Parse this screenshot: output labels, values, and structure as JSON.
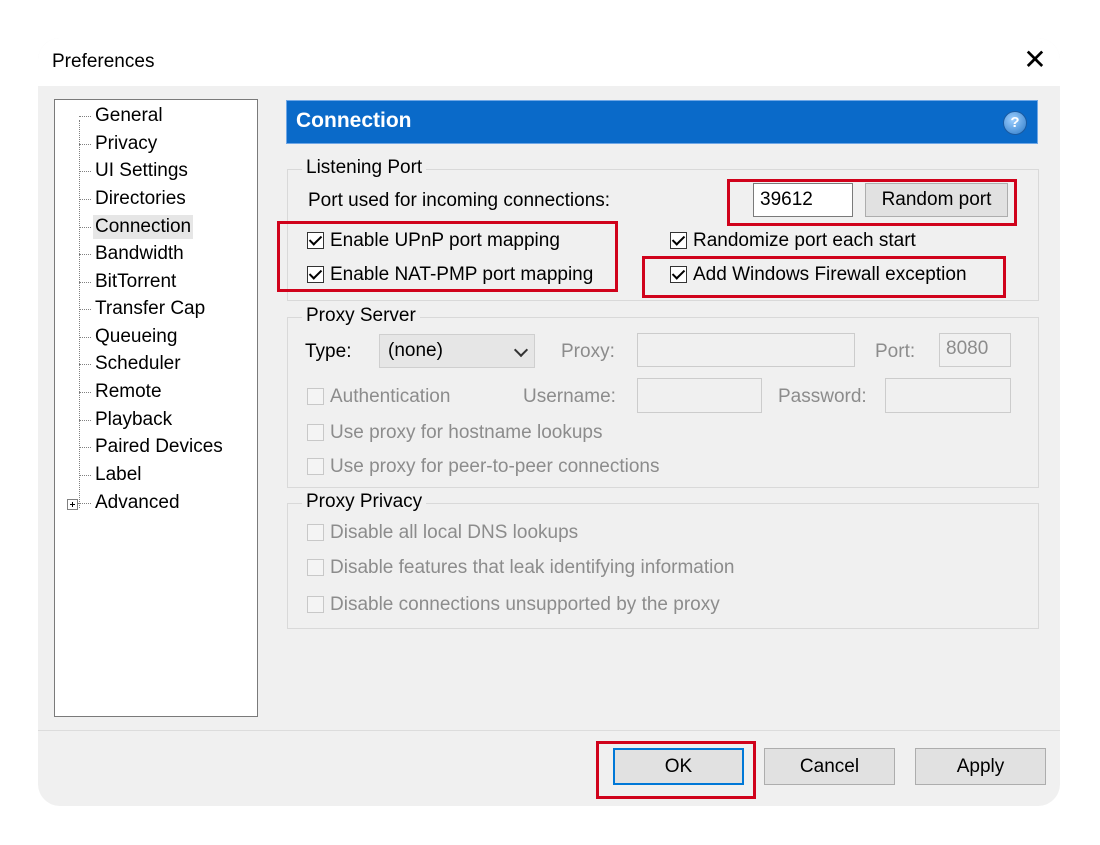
{
  "window": {
    "title": "Preferences",
    "close_glyph": "✕"
  },
  "sidebar": {
    "items": [
      {
        "label": "General"
      },
      {
        "label": "Privacy"
      },
      {
        "label": "UI Settings"
      },
      {
        "label": "Directories"
      },
      {
        "label": "Connection",
        "selected": true
      },
      {
        "label": "Bandwidth"
      },
      {
        "label": "BitTorrent"
      },
      {
        "label": "Transfer Cap"
      },
      {
        "label": "Queueing"
      },
      {
        "label": "Scheduler"
      },
      {
        "label": "Remote"
      },
      {
        "label": "Playback"
      },
      {
        "label": "Paired Devices"
      },
      {
        "label": "Label"
      },
      {
        "label": "Advanced",
        "expandable": true
      }
    ]
  },
  "header": {
    "title": "Connection",
    "help_glyph": "?"
  },
  "listening_port": {
    "group_label": "Listening Port",
    "port_label": "Port used for incoming connections:",
    "port_value": "39612",
    "random_port_button": "Random port",
    "upnp_label": "Enable UPnP port mapping",
    "upnp_checked": true,
    "natpmp_label": "Enable NAT-PMP port mapping",
    "natpmp_checked": true,
    "randomize_label": "Randomize port each start",
    "randomize_checked": true,
    "firewall_label": "Add Windows Firewall exception",
    "firewall_checked": true
  },
  "proxy_server": {
    "group_label": "Proxy Server",
    "type_label": "Type:",
    "type_value": "(none)",
    "proxy_label": "Proxy:",
    "proxy_value": "",
    "port_label": "Port:",
    "port_value": "8080",
    "auth_label": "Authentication",
    "username_label": "Username:",
    "username_value": "",
    "password_label": "Password:",
    "password_value": "",
    "hostname_label": "Use proxy for hostname lookups",
    "p2p_label": "Use proxy for peer-to-peer connections"
  },
  "proxy_privacy": {
    "group_label": "Proxy Privacy",
    "dns_label": "Disable all local DNS lookups",
    "leak_label": "Disable features that leak identifying information",
    "unsupported_label": "Disable connections unsupported by the proxy"
  },
  "footer": {
    "ok_label": "OK",
    "cancel_label": "Cancel",
    "apply_label": "Apply"
  },
  "colors": {
    "header_blue": "#0a6ac9",
    "highlight_red": "#d0021b",
    "default_button_border": "#0078d7"
  }
}
